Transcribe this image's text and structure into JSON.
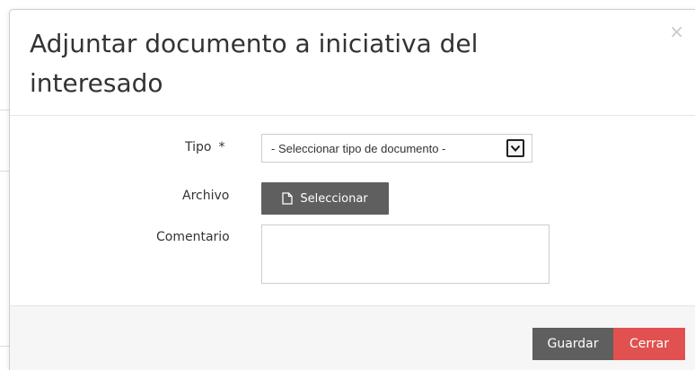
{
  "modal": {
    "title": "Adjuntar documento a iniciativa del interesado",
    "close_glyph": "×"
  },
  "form": {
    "tipo": {
      "label": "Tipo",
      "required_mark": "*",
      "selected": "- Seleccionar tipo de documento -"
    },
    "archivo": {
      "label": "Archivo",
      "button_label": "Seleccionar",
      "icon": "file-icon"
    },
    "comentario": {
      "label": "Comentario",
      "value": ""
    }
  },
  "footer": {
    "save_label": "Guardar",
    "close_label": "Cerrar"
  },
  "colors": {
    "primary_button": "#5f5f5f",
    "danger_button": "#e0514f",
    "footer_background": "#f6f6f6"
  }
}
